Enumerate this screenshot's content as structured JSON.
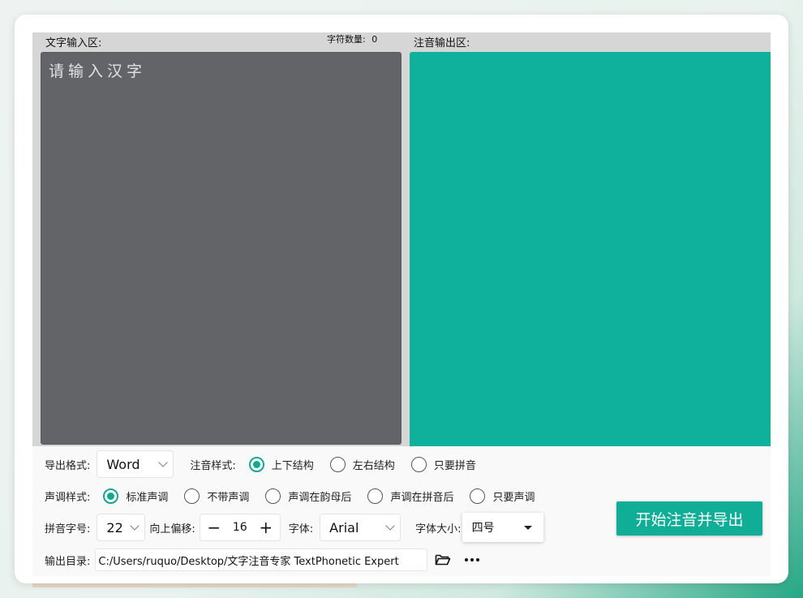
{
  "input_area": {
    "label": "文字输入区:",
    "char_count_label": "字符数量:",
    "char_count_value": "0",
    "placeholder": "请输入汉字"
  },
  "output_area": {
    "label": "注音输出区:"
  },
  "export_format": {
    "label": "导出格式:",
    "value": "Word"
  },
  "phonetic_style": {
    "label": "注音样式:",
    "options": [
      "上下结构",
      "左右结构",
      "只要拼音"
    ],
    "selected": 0
  },
  "tone_style": {
    "label": "声调样式:",
    "options": [
      "标准声调",
      "不带声调",
      "声调在韵母后",
      "声调在拼音后",
      "只要声调"
    ],
    "selected": 0
  },
  "pinyin_size": {
    "label": "拼音字号:",
    "value": "22"
  },
  "offset": {
    "label": "向上偏移:",
    "value": "16",
    "minus": "−",
    "plus": "+"
  },
  "font": {
    "label": "字体:",
    "value": "Arial"
  },
  "font_size": {
    "label": "字体大小:",
    "value": "四号"
  },
  "output_dir": {
    "label": "输出目录:",
    "value": "C:/Users/ruquo/Desktop/文字注音专家 TextPhonetic Expert"
  },
  "start_button": {
    "label": "开始注音并导出"
  },
  "colors": {
    "accent": "#10ad97",
    "input_bg": "#636468",
    "output_bg": "#0fb09c"
  }
}
